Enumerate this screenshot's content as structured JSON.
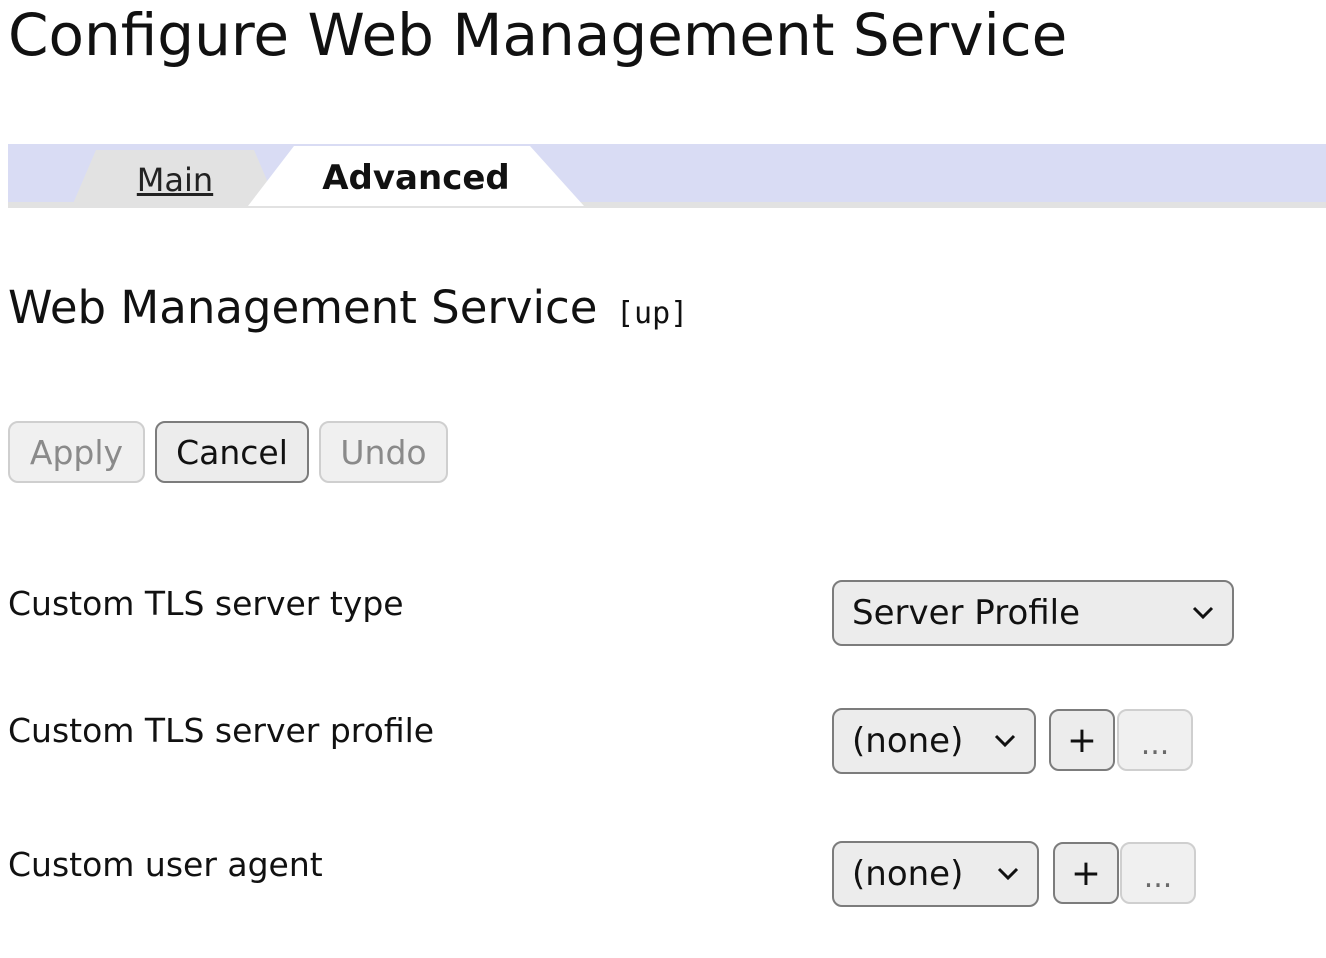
{
  "page": {
    "title": "Configure Web Management Service"
  },
  "tabs": [
    {
      "label": "Main",
      "active": false
    },
    {
      "label": "Advanced",
      "active": true
    }
  ],
  "section": {
    "title": "Web Management Service",
    "status": "[up]"
  },
  "actions": {
    "apply_label": "Apply",
    "cancel_label": "Cancel",
    "undo_label": "Undo"
  },
  "fields": [
    {
      "label": "Custom TLS server type",
      "value": "Server Profile"
    },
    {
      "label": "Custom TLS server profile",
      "value": "(none)",
      "add_label": "+",
      "more_label": "..."
    },
    {
      "label": "Custom user agent",
      "value": "(none)",
      "add_label": "+",
      "more_label": "..."
    }
  ],
  "colors": {
    "tab_strip": "#d9dcf4",
    "inactive_tab": "#e2e2e2",
    "button_border": "#7c7c7c"
  }
}
